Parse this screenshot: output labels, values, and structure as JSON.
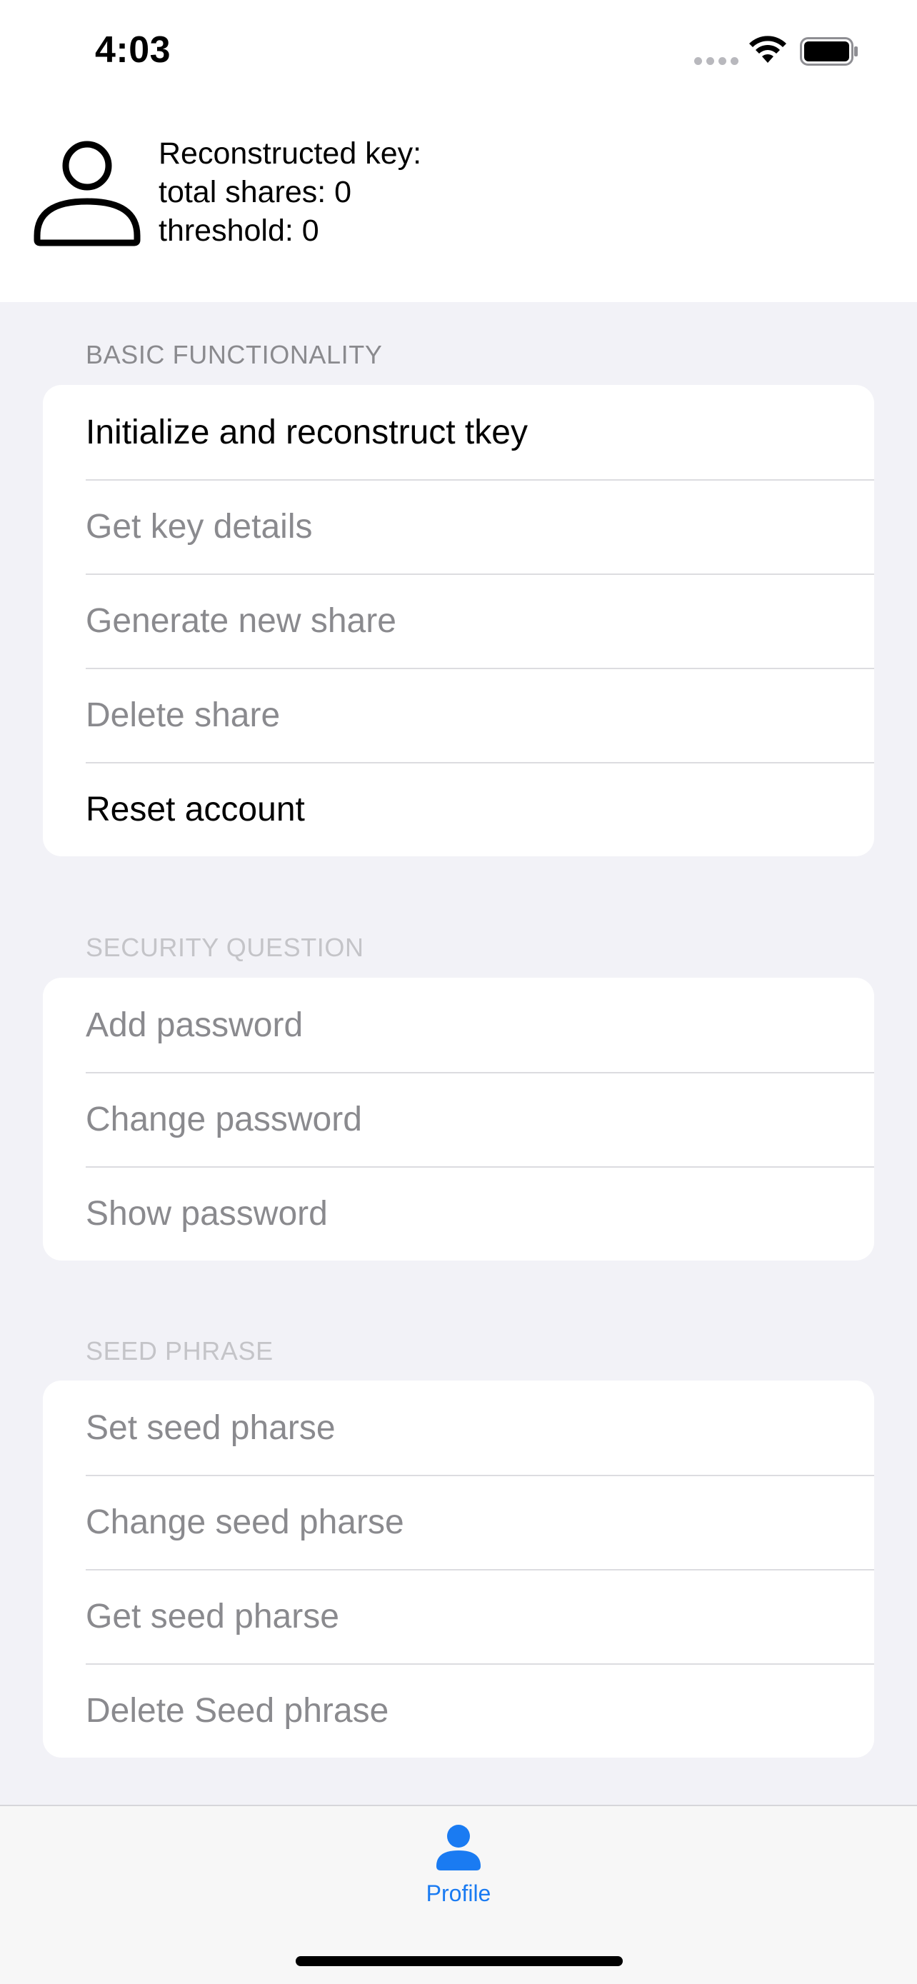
{
  "status_bar": {
    "time": "4:03"
  },
  "header": {
    "lines": [
      "Reconstructed key:",
      "total shares: 0",
      "threshold: 0"
    ]
  },
  "sections": [
    {
      "title": "BASIC FUNCTIONALITY",
      "items": [
        {
          "label": "Initialize and reconstruct tkey",
          "enabled": true
        },
        {
          "label": "Get key details",
          "enabled": false
        },
        {
          "label": "Generate new share",
          "enabled": false
        },
        {
          "label": "Delete share",
          "enabled": false
        },
        {
          "label": "Reset account",
          "enabled": true
        }
      ]
    },
    {
      "title": "SECURITY QUESTION",
      "items": [
        {
          "label": "Add password",
          "enabled": false
        },
        {
          "label": "Change password",
          "enabled": false
        },
        {
          "label": "Show password",
          "enabled": false
        }
      ]
    },
    {
      "title": "SEED PHRASE",
      "items": [
        {
          "label": "Set seed pharse",
          "enabled": false
        },
        {
          "label": "Change seed pharse",
          "enabled": false
        },
        {
          "label": "Get seed pharse",
          "enabled": false
        },
        {
          "label": "Delete Seed phrase",
          "enabled": false
        }
      ]
    }
  ],
  "tab_bar": {
    "tabs": [
      {
        "label": "Profile",
        "icon": "person-icon",
        "selected": true
      }
    ]
  },
  "colors": {
    "accent": "#1a7bf2",
    "disabled_text": "#8a8a8e",
    "background": "#f2f2f7"
  }
}
